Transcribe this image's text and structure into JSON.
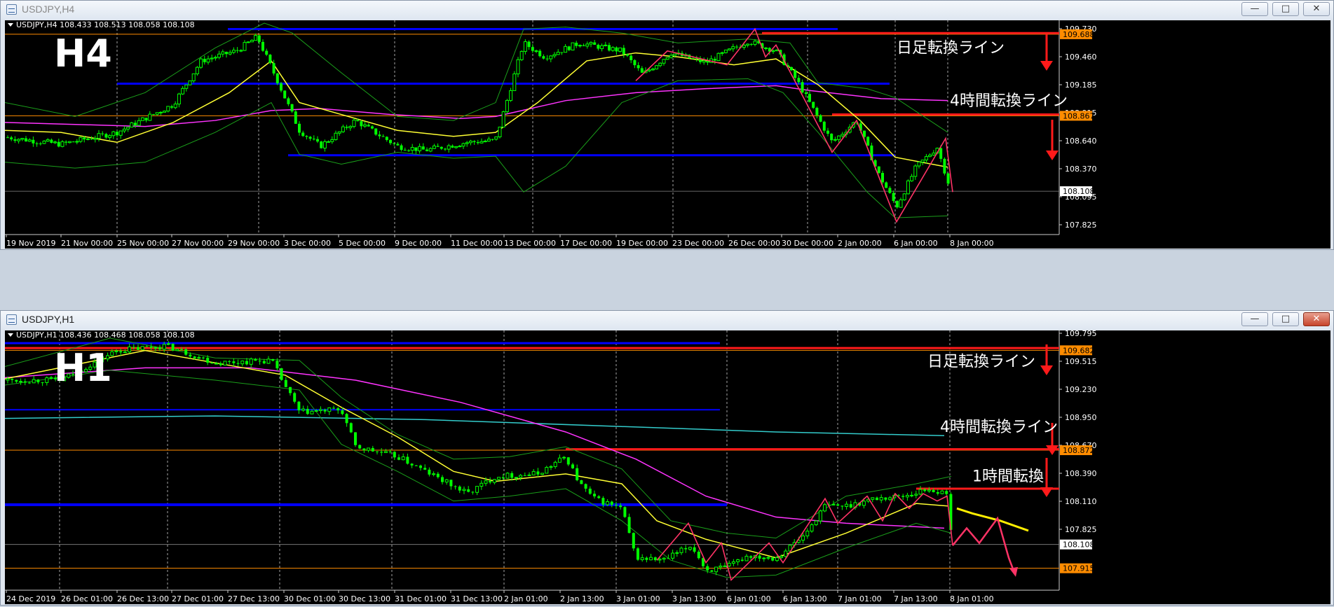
{
  "windows": [
    {
      "title": "USDJPY,H4",
      "info": "USDJPY,H4  108.433 108.513 108.058 108.108",
      "timeframe_label": "H4",
      "price_labels": [
        "109.730",
        "109.460",
        "109.185",
        "108.915",
        "108.640",
        "108.370",
        "108.095",
        "107.825"
      ],
      "badges": [
        {
          "text": "109.688",
          "color": "#ff8c00",
          "textColor": "#000000",
          "price": 109.688
        },
        {
          "text": "108.867",
          "color": "#ff8c00",
          "textColor": "#000000",
          "price": 108.867
        },
        {
          "text": "108.108",
          "color": "#ffffff",
          "textColor": "#000000",
          "price": 108.108
        }
      ],
      "time_labels": [
        "19 Nov 2019",
        "21 Nov 00:00",
        "25 Nov 00:00",
        "27 Nov 00:00",
        "29 Nov 00:00",
        "3 Dec 00:00",
        "5 Dec 00:00",
        "9 Dec 00:00",
        "11 Dec 00:00",
        "13 Dec 00:00",
        "17 Dec 00:00",
        "19 Dec 00:00",
        "23 Dec 00:00",
        "26 Dec 00:00",
        "30 Dec 00:00",
        "2 Jan 00:00",
        "6 Jan 00:00",
        "8 Jan 00:00"
      ],
      "annotations": [
        {
          "text": "日足転換ライン",
          "price": 109.5
        },
        {
          "text": "4時間転換ライン",
          "price": 108.97
        }
      ],
      "price_range": [
        107.7,
        109.8
      ]
    },
    {
      "title": "USDJPY,H1",
      "info": "USDJPY,H1  108.436 108.468 108.058 108.108",
      "timeframe_label": "H1",
      "price_labels": [
        "109.795",
        "109.515",
        "109.230",
        "108.950",
        "108.670",
        "108.390",
        "108.110",
        "107.825"
      ],
      "badges": [
        {
          "text": "109.682",
          "color": "#ff8c00",
          "textColor": "#000000",
          "price": 109.682
        },
        {
          "text": "108.872",
          "color": "#ff8c00",
          "textColor": "#000000",
          "price": 108.872
        },
        {
          "text": "108.108",
          "color": "#ffffff",
          "textColor": "#000000",
          "price": 108.108
        },
        {
          "text": "107.915",
          "color": "#ff8c00",
          "textColor": "#000000",
          "price": 107.915
        }
      ],
      "time_labels": [
        "24 Dec 2019",
        "26 Dec 01:00",
        "26 Dec 13:00",
        "27 Dec 01:00",
        "27 Dec 13:00",
        "30 Dec 01:00",
        "30 Dec 13:00",
        "31 Dec 01:00",
        "31 Dec 13:00",
        "2 Jan 01:00",
        "2 Jan 13:00",
        "3 Jan 01:00",
        "3 Jan 13:00",
        "6 Jan 01:00",
        "6 Jan 13:00",
        "7 Jan 01:00",
        "7 Jan 13:00",
        "8 Jan 01:00"
      ],
      "annotations": [
        {
          "text": "日足転換ライン",
          "price": 109.55
        },
        {
          "text": "4時間転換ライン",
          "price": 109.02
        },
        {
          "text": "1時間転換",
          "price": 108.62
        }
      ],
      "price_range": [
        107.76,
        109.82
      ]
    }
  ],
  "colors": {
    "bull": "#00ff00",
    "bear": "#00ff00",
    "ma_fast": "#ffff33",
    "ma_slow": "#ff33ff",
    "bands": "#1a9e1a",
    "support": "#0000ff",
    "turn": "#ff1a1a",
    "zigzag": "#ff3366",
    "cyan": "#33cccc"
  }
}
